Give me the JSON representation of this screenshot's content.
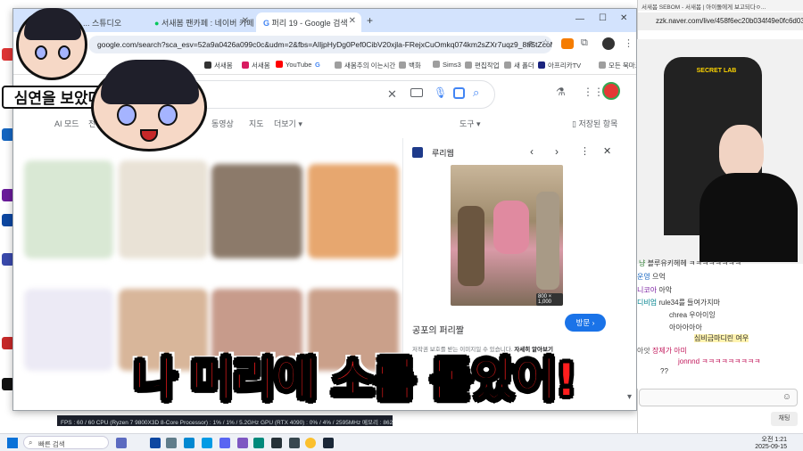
{
  "tabs": [
    {
      "label": "... 스튜디오"
    },
    {
      "label": "서새봄 팬카페 : 네이버 카페"
    },
    {
      "label": "퍼리 19 - Google 검색"
    }
  ],
  "omnibox": {
    "url": "google.com/search?sca_esv=52a9a0426a099c0c&udm=2&fbs=AIljpHyDg0Pef0CibV20xjla-FRejxCuOmkq074km2sZXr7uqz9_8tiStZcoMiP-q5iA..."
  },
  "bookmarks": [
    {
      "label": "서새봄"
    },
    {
      "label": "서새봄"
    },
    {
      "label": "YouTube"
    },
    {
      "label": "G"
    },
    {
      "label": "새봄추의 이는시간"
    },
    {
      "label": "백화"
    },
    {
      "label": "Sims3"
    },
    {
      "label": "편집작업"
    },
    {
      "label": "새 폴더"
    },
    {
      "label": "아프리카TV"
    },
    {
      "label": "모든 북마크"
    }
  ],
  "google": {
    "nav_tabs": [
      "AI 모드",
      "전체",
      "동영상",
      "지도",
      "더보기 ▾"
    ],
    "tools_label": "도구 ▾",
    "saved_label": "저장된 항목"
  },
  "panel": {
    "source": "루리웹",
    "image_size": "800 × 1,000",
    "title": "공포의 퍼리짤",
    "visit_label": "방문 ›",
    "copyright": "저작권 보호를 받는 이미지일 수 있습니다.",
    "learn_more": "자세히 알아보기"
  },
  "sticker": {
    "label": "심연을 보았다"
  },
  "caption": {
    "text": "나 머리에 소름 돋았어!"
  },
  "stats": {
    "text": "FPS : 60 / 60    CPU (Ryzen 7 9800X3D 8-Core Processor) : 1% / 1% / 5.2GHz    GPU (RTX 4090) : 0% / 4% / 2595MHz    메모리 : 862 MB"
  },
  "stream": {
    "title": "서새봄 SEBOM - 서새봄 | 아이돌에게 보고되다ㅇ...",
    "url": "zzk.naver.com/live/458f6ec20b034f49e0fc6d039216...",
    "chat": [
      {
        "name": "냥",
        "msg": "블루유키헤헤 ㅋㅋㅋㅋㅋㅋㅋㅋ"
      },
      {
        "name": "운영",
        "msg": "으억"
      },
      {
        "name": "니코아",
        "msg": "아악"
      },
      {
        "name": "디비업",
        "msg": "rule34를 들여가지마"
      },
      {
        "name": "",
        "msg": "chrea 우아이잉"
      },
      {
        "name": "",
        "msg": "아아아아아"
      },
      {
        "name": "",
        "msg": "심비금마디린 여우"
      },
      {
        "name": "아앗",
        "msg": "장제가 아미"
      },
      {
        "name": "",
        "msg": "jonnnd ㅋㅋㅋㅋㅋㅋㅋㅋㅋ"
      },
      {
        "name": "",
        "msg": "??"
      }
    ],
    "send_label": "채팅"
  },
  "taskbar": {
    "search_placeholder": "빠른 검색",
    "time": "오전 1:21",
    "date": "2025-09-15"
  }
}
